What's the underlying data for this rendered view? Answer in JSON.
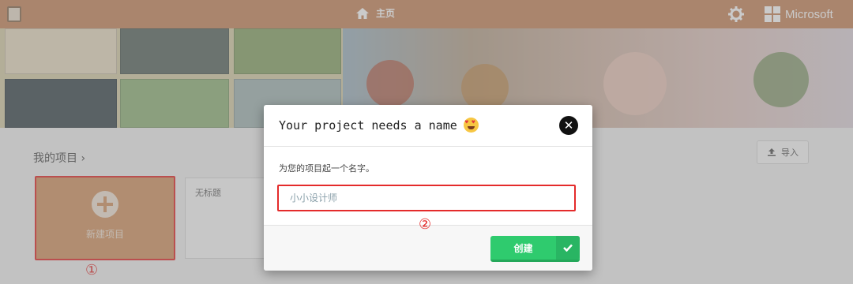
{
  "topbar": {
    "home_label": "主页",
    "brand": "Microsoft",
    "bg": "#c9895f"
  },
  "section": {
    "title": "我的项目",
    "import_label": "导入"
  },
  "cards": {
    "new_project_label": "新建项目",
    "untitled_label": "无标题"
  },
  "modal": {
    "title": "Your project needs a name",
    "label": "为您的项目起一个名字。",
    "input_placeholder": "小小设计师",
    "create_label": "创建",
    "close_icon": "close-icon"
  },
  "annotations": {
    "one": "①",
    "two": "②"
  },
  "colors": {
    "accent_green": "#2fcb6e",
    "annotation_red": "#e42b2b",
    "card_orange": "#d49766"
  }
}
